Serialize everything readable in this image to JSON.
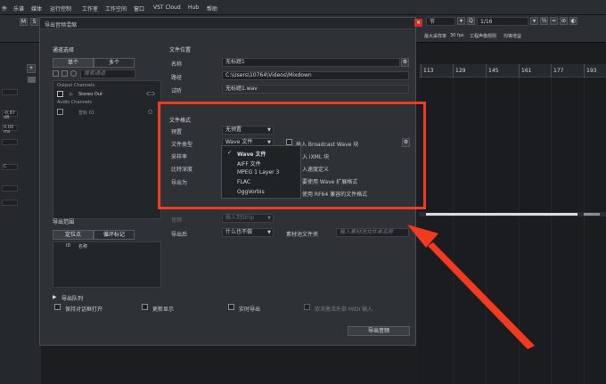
{
  "menubar": {
    "items": [
      "件",
      "乐谱",
      "媒体",
      "运行控制",
      "工作室",
      "工作空间",
      "窗口",
      "VST Cloud",
      "Hub",
      "帮助"
    ]
  },
  "toolbar": {
    "m_label": "M",
    "s_label": "S",
    "position_value": "节",
    "quantize_value": "1/16",
    "project_status": [
      "最大采样率",
      "30 fps",
      "工程声像规则",
      "均等增益"
    ]
  },
  "ruler": {
    "marks": [
      "113",
      "129",
      "145",
      "161",
      "177",
      "193"
    ]
  },
  "left_panel": {
    "values": [
      "-0.87 dB",
      "0.00 ms",
      "C"
    ]
  },
  "dialog": {
    "title": "导出音频混缩",
    "channel_section": {
      "title": "通道选择",
      "tab_mono": "单个",
      "tab_multi": "多个",
      "search_placeholder": "搜索通道",
      "group_output": "Output Channels",
      "stereo_out": "Stereo Out",
      "group_audio": "Audio Channels",
      "audio_track": "音轨 01"
    },
    "range_section": {
      "title": "导出范围",
      "tab_locators": "定位点",
      "tab_cycle": "循环标记",
      "col_id": "ID",
      "col_name": "名称"
    },
    "file_location": {
      "title": "文件位置",
      "name_label": "名称",
      "name_value": "无标题1",
      "path_label": "路径",
      "path_value": "C:\\Users\\10764\\Videos\\Mixdown",
      "preview_label": "试听",
      "preview_value": "无标题1.wav"
    },
    "file_format": {
      "title": "文件格式",
      "preset_label": "预置",
      "preset_value": "无预置",
      "type_label": "文件类型",
      "type_value": "Wave 文件",
      "sample_rate_label": "采样率",
      "bit_depth_label": "比特深度",
      "export_as_label": "导出为",
      "options": [
        "Wave 文件",
        "AIFF 文件",
        "MPEG 1 Layer 3",
        "FLAC",
        "OggVorbis"
      ],
      "selected_option": "Wave 文件",
      "broadcast_label": "插入 Broadcast Wave 块",
      "ixml_label": "入 iXML 块",
      "tempo_label": "入速度定义",
      "wave_ext_label": "要使用 Wave 扩展格式",
      "rf64_label": "使用 RF64 兼容的文件格式"
    },
    "after_export": {
      "insert_label": "音频",
      "insert_value": "插入到Strip",
      "after_label": "导出后",
      "after_value": "什么也不做",
      "pool_label": "素材池文件夹",
      "pool_placeholder": "输入素材池文件夹名称"
    },
    "queue": {
      "title": "导出队列",
      "keep_open": "保持对话框打开",
      "update_display": "更新显示",
      "realtime": "实时导出",
      "external_midi": "取消激活外部 MIDI 输入"
    },
    "export_button": "导出音频"
  },
  "colors": {
    "annotation": "#f23a1e",
    "dialog_bg": "#2e3135",
    "accent_blue": "#4a7cd6"
  }
}
